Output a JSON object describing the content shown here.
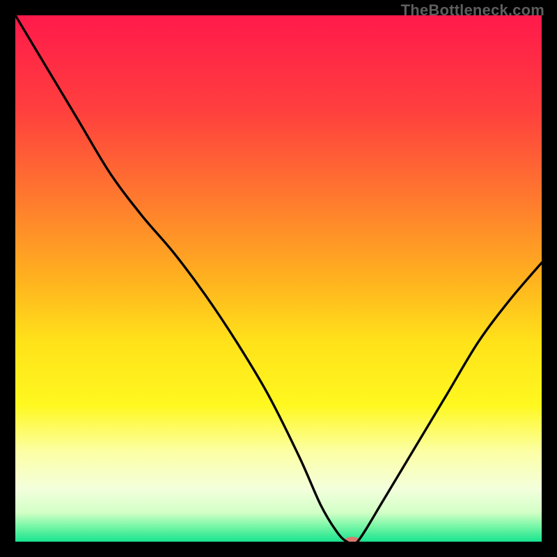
{
  "watermark": "TheBottleneck.com",
  "chart_data": {
    "type": "line",
    "title": "",
    "xlabel": "",
    "ylabel": "",
    "xlim": [
      0,
      100
    ],
    "ylim": [
      0,
      100
    ],
    "grid": false,
    "legend": false,
    "background_gradient": {
      "stops": [
        {
          "offset": 0.0,
          "color": "#ff1a4b"
        },
        {
          "offset": 0.18,
          "color": "#ff3f3e"
        },
        {
          "offset": 0.35,
          "color": "#ff7a2e"
        },
        {
          "offset": 0.5,
          "color": "#ffb11f"
        },
        {
          "offset": 0.62,
          "color": "#ffe21a"
        },
        {
          "offset": 0.74,
          "color": "#fff81f"
        },
        {
          "offset": 0.83,
          "color": "#fcffa6"
        },
        {
          "offset": 0.9,
          "color": "#f3ffdc"
        },
        {
          "offset": 0.945,
          "color": "#d2ffc6"
        },
        {
          "offset": 0.97,
          "color": "#7af7a7"
        },
        {
          "offset": 1.0,
          "color": "#18e38f"
        }
      ]
    },
    "series": [
      {
        "name": "bottleneck-curve",
        "color": "#000000",
        "x": [
          0,
          6,
          12,
          18,
          24,
          30,
          36,
          42,
          48,
          54,
          58,
          61,
          63,
          65,
          70,
          76,
          82,
          88,
          94,
          100
        ],
        "y": [
          100,
          90,
          80,
          70,
          62,
          55,
          47,
          38,
          28,
          16,
          7,
          2,
          0,
          0,
          8,
          18,
          28,
          38,
          46,
          53
        ]
      }
    ],
    "marker": {
      "name": "optimal-point",
      "x": 64,
      "y": 0,
      "color": "#d97a6f",
      "rx": 12,
      "ry": 7
    }
  }
}
